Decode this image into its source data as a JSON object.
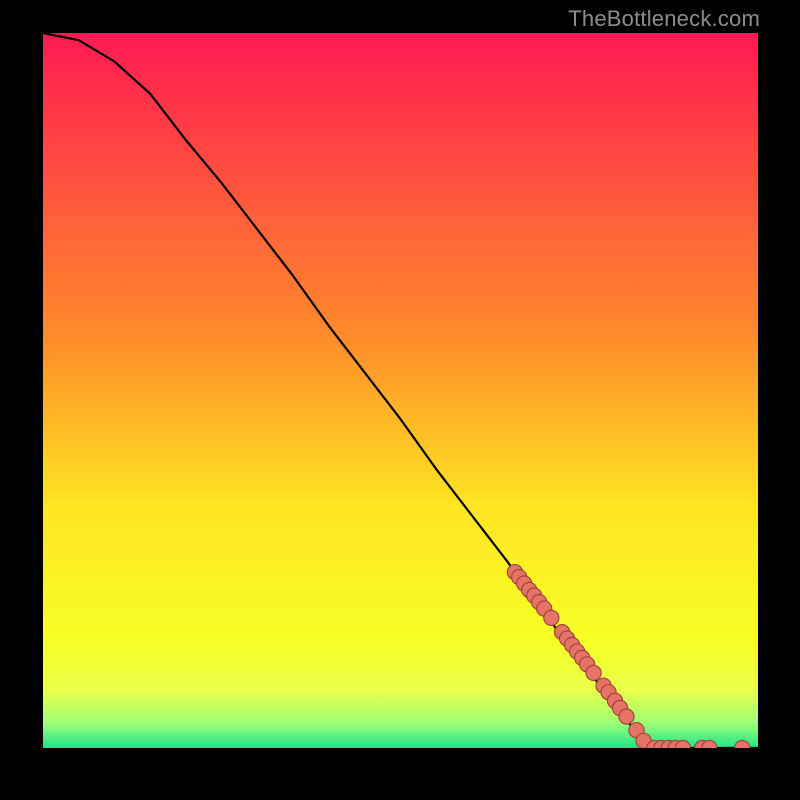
{
  "attribution": "TheBottleneck.com",
  "colors": {
    "frame": "#000000",
    "grad_top": "#ff1a52",
    "grad_upper_mid": "#ff8a2b",
    "grad_mid": "#ffe422",
    "grad_lower_mid": "#f7ff26",
    "grad_band_top": "#e9ff4a",
    "grad_band_bottom": "#9eff77",
    "grad_green": "#1ee48a",
    "curve": "#000000",
    "marker_fill": "#e57366",
    "marker_stroke": "#9b3f36"
  },
  "chart_data": {
    "type": "line",
    "title": "",
    "xlabel": "",
    "ylabel": "",
    "xlim": [
      0,
      100
    ],
    "ylim": [
      0,
      100
    ],
    "series": [
      {
        "name": "curve",
        "kind": "line",
        "points": [
          {
            "x": 0,
            "y": 100
          },
          {
            "x": 5,
            "y": 99
          },
          {
            "x": 10,
            "y": 96
          },
          {
            "x": 15,
            "y": 91.5
          },
          {
            "x": 20,
            "y": 85
          },
          {
            "x": 25,
            "y": 79
          },
          {
            "x": 30,
            "y": 72.5
          },
          {
            "x": 35,
            "y": 66
          },
          {
            "x": 40,
            "y": 59
          },
          {
            "x": 45,
            "y": 52.5
          },
          {
            "x": 50,
            "y": 46
          },
          {
            "x": 55,
            "y": 39
          },
          {
            "x": 60,
            "y": 32.5
          },
          {
            "x": 65,
            "y": 26
          },
          {
            "x": 70,
            "y": 19
          },
          {
            "x": 75,
            "y": 12.5
          },
          {
            "x": 80,
            "y": 6
          },
          {
            "x": 84.7,
            "y": 0
          },
          {
            "x": 100,
            "y": 0
          }
        ]
      },
      {
        "name": "markers",
        "kind": "scatter",
        "points": [
          {
            "x": 66.0,
            "y": 24.6
          },
          {
            "x": 66.6,
            "y": 23.9
          },
          {
            "x": 67.3,
            "y": 23.0
          },
          {
            "x": 68.0,
            "y": 22.1
          },
          {
            "x": 68.7,
            "y": 21.3
          },
          {
            "x": 69.4,
            "y": 20.4
          },
          {
            "x": 70.1,
            "y": 19.5
          },
          {
            "x": 71.1,
            "y": 18.2
          },
          {
            "x": 72.6,
            "y": 16.2
          },
          {
            "x": 73.3,
            "y": 15.3
          },
          {
            "x": 74.0,
            "y": 14.4
          },
          {
            "x": 74.7,
            "y": 13.5
          },
          {
            "x": 75.4,
            "y": 12.6
          },
          {
            "x": 76.1,
            "y": 11.7
          },
          {
            "x": 77.0,
            "y": 10.5
          },
          {
            "x": 78.4,
            "y": 8.7
          },
          {
            "x": 79.1,
            "y": 7.8
          },
          {
            "x": 80.0,
            "y": 6.6
          },
          {
            "x": 80.7,
            "y": 5.6
          },
          {
            "x": 81.6,
            "y": 4.4
          },
          {
            "x": 83.0,
            "y": 2.5
          },
          {
            "x": 84.0,
            "y": 1.0
          },
          {
            "x": 85.5,
            "y": 0.0
          },
          {
            "x": 86.5,
            "y": 0.0
          },
          {
            "x": 87.5,
            "y": 0.0
          },
          {
            "x": 88.5,
            "y": 0.0
          },
          {
            "x": 89.5,
            "y": 0.0
          },
          {
            "x": 92.2,
            "y": 0.0
          },
          {
            "x": 93.2,
            "y": 0.0
          },
          {
            "x": 97.8,
            "y": 0.0
          }
        ]
      }
    ]
  }
}
